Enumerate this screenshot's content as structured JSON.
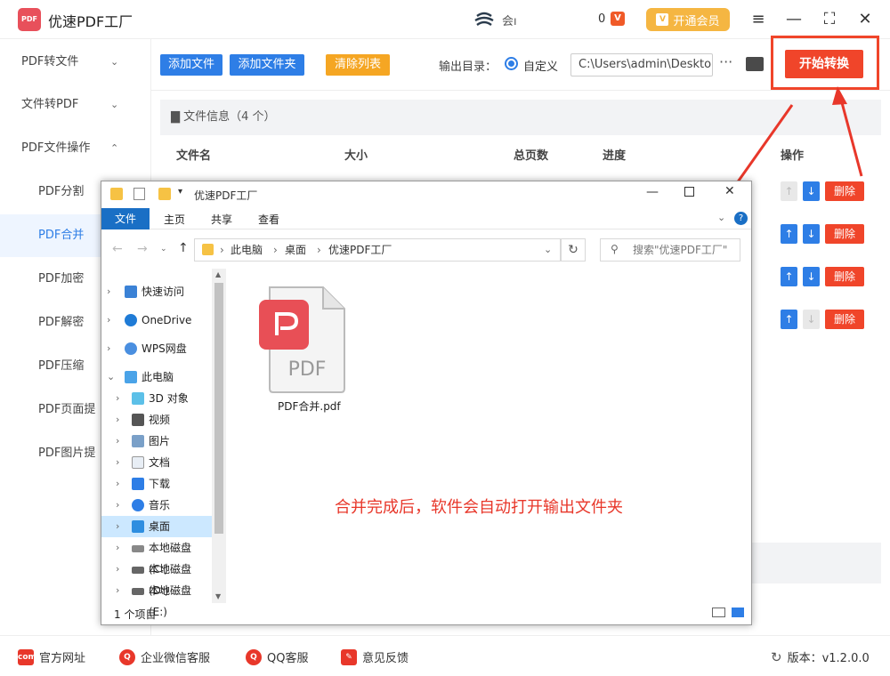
{
  "app": {
    "title": "优速PDF工厂",
    "logo_text": "PDF",
    "user_name": "会ı",
    "coins": "0",
    "vip_badge": "V",
    "vip_label": "开通会员",
    "window_buttons": [
      "≡",
      "—",
      "⛶",
      "✕"
    ]
  },
  "sidebar": {
    "items": [
      {
        "label": "PDF转文件",
        "chevron": "⌄"
      },
      {
        "label": "文件转PDF",
        "chevron": "⌄"
      },
      {
        "label": "PDF文件操作",
        "chevron": "⌃"
      },
      {
        "label": "PDF分割"
      },
      {
        "label": "PDF合并"
      },
      {
        "label": "PDF加密"
      },
      {
        "label": "PDF解密"
      },
      {
        "label": "PDF压缩"
      },
      {
        "label": "PDF页面提"
      },
      {
        "label": "PDF图片提"
      }
    ]
  },
  "toolbar": {
    "add_file": "添加文件",
    "add_folder": "添加文件夹",
    "clear_list": "清除列表",
    "output_label": "输出目录：",
    "custom_option": "自定义",
    "output_path": "C:\\Users\\admin\\Deskto",
    "more": "···",
    "start": "开始转换"
  },
  "file_list": {
    "info": "文件信息（4 个）",
    "columns": [
      "文件名",
      "大小",
      "总页数",
      "进度",
      "操作"
    ],
    "rows": [
      {
        "up": "↑",
        "down": "↓",
        "delete": "删除"
      },
      {
        "up": "↑",
        "down": "↓",
        "delete": "删除"
      },
      {
        "up": "↑",
        "down": "↓",
        "delete": "删除"
      },
      {
        "up": "↑",
        "down": "↓",
        "delete": "删除"
      }
    ]
  },
  "explorer": {
    "title": "优速PDF工厂",
    "ribbon_tabs": [
      "文件",
      "主页",
      "共享",
      "查看"
    ],
    "breadcrumb": [
      "此电脑",
      "桌面",
      "优速PDF工厂"
    ],
    "search_placeholder": "搜索\"优速PDF工厂\"",
    "nav": [
      {
        "label": "快速访问",
        "icon": "star-icon"
      },
      {
        "label": "OneDrive",
        "icon": "cloud-icon"
      },
      {
        "label": "WPS网盘",
        "icon": "wps-cloud-icon"
      },
      {
        "label": "此电脑",
        "icon": "computer-icon"
      },
      {
        "label": "3D 对象",
        "icon": "3d-objects-icon"
      },
      {
        "label": "视频",
        "icon": "video-icon"
      },
      {
        "label": "图片",
        "icon": "picture-icon"
      },
      {
        "label": "文档",
        "icon": "document-icon"
      },
      {
        "label": "下载",
        "icon": "download-icon"
      },
      {
        "label": "音乐",
        "icon": "music-icon"
      },
      {
        "label": "桌面",
        "icon": "desktop-icon"
      },
      {
        "label": "本地磁盘 (C:)",
        "icon": "drive-icon"
      },
      {
        "label": "本地磁盘 (D:)",
        "icon": "drive-icon"
      },
      {
        "label": "本地磁盘 (E:)",
        "icon": "drive-icon"
      }
    ],
    "file_name": "PDF合并.pdf",
    "file_icon_text": "PDF",
    "message": "合并完成后，软件会自动打开输出文件夹",
    "status": "1 个项目"
  },
  "footer": {
    "website": "官方网址",
    "wechat": "企业微信客服",
    "qq": "QQ客服",
    "feedback": "意见反馈",
    "version": "版本：v1.2.0.0"
  },
  "colors": {
    "accent_blue": "#2e7ee6",
    "start_red": "#f0452a",
    "clear_orange": "#f5a623",
    "vip_gold": "#f5b642",
    "message_red": "#e8372a"
  }
}
